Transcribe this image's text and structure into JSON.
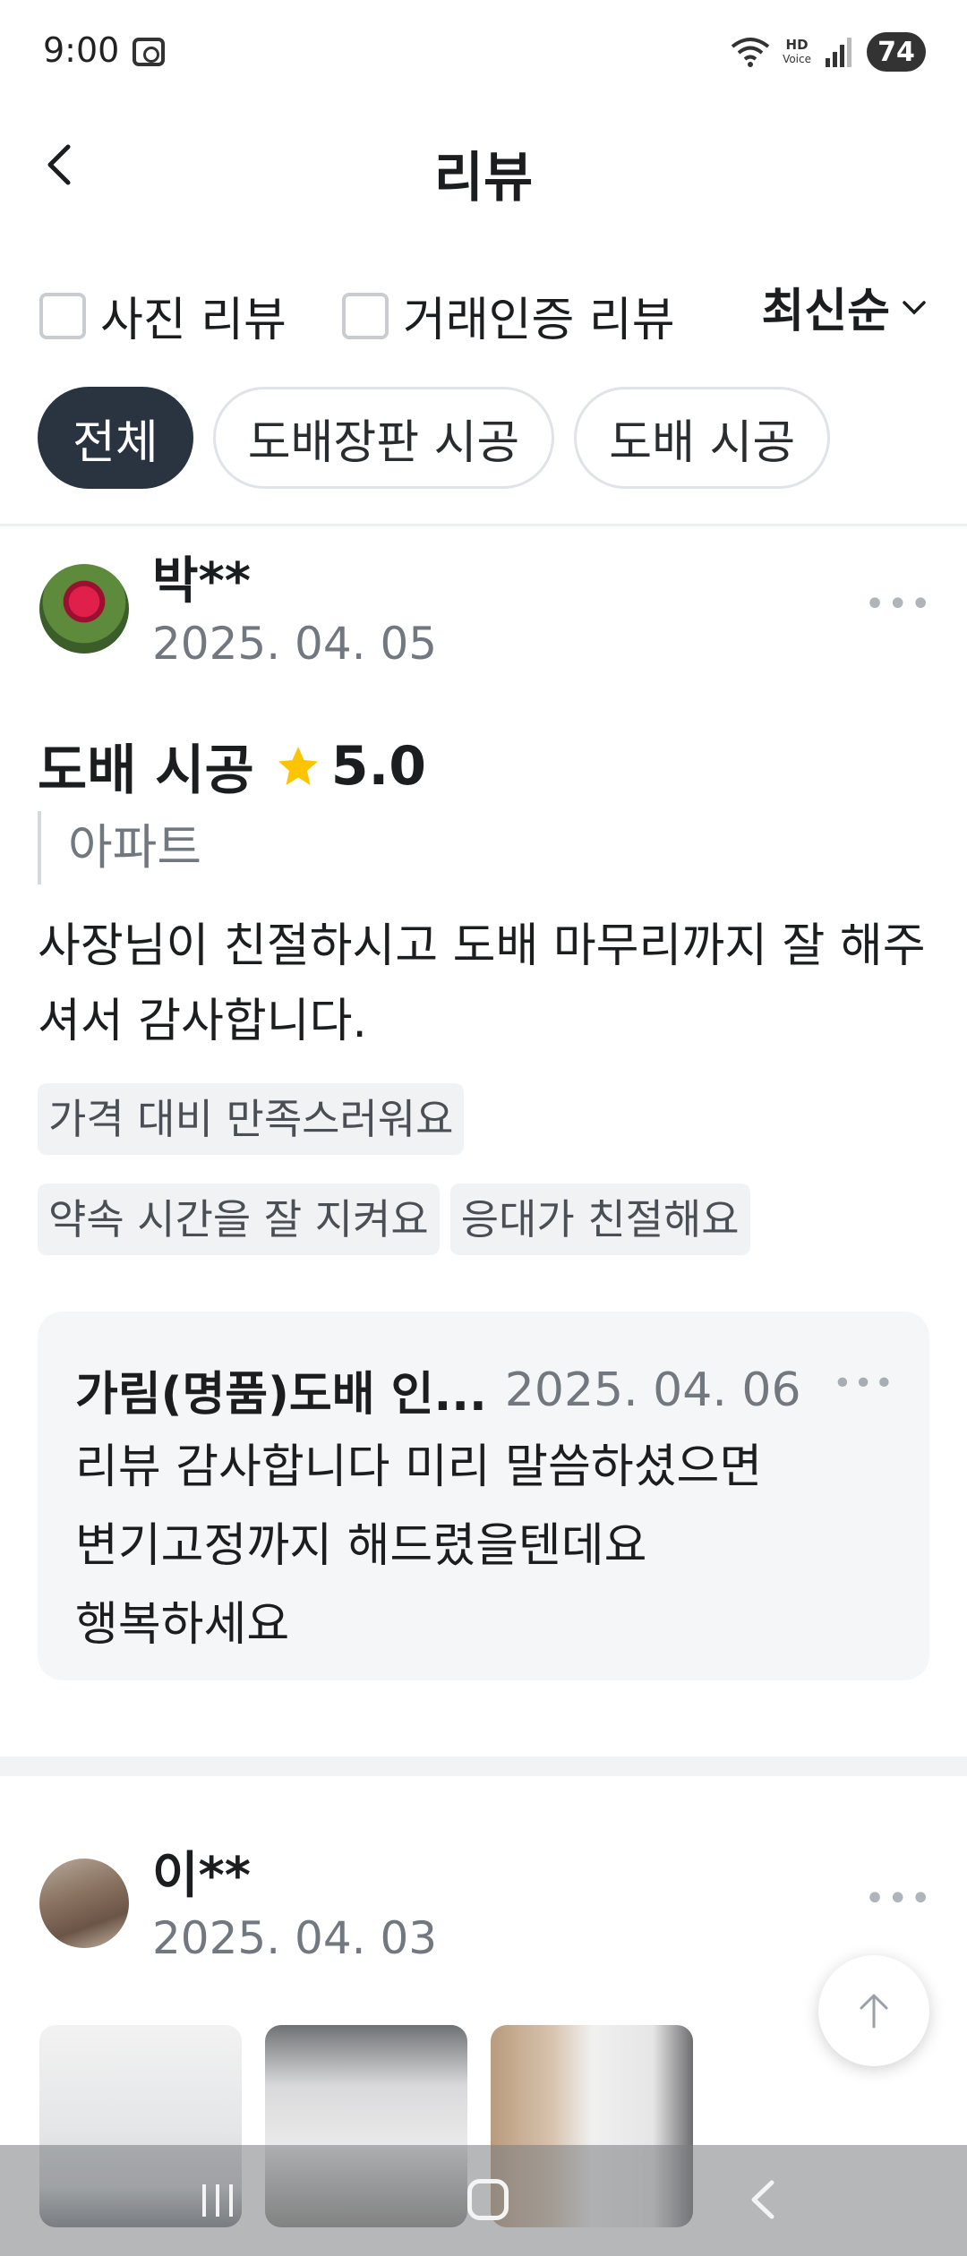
{
  "status": {
    "time": "9:00",
    "hd_label": "HD",
    "voice_label": "Voice",
    "battery": "74"
  },
  "header": {
    "title": "리뷰"
  },
  "filters": {
    "photo_review": "사진 리뷰",
    "verified_review": "거래인증 리뷰",
    "sort": "최신순"
  },
  "chips": [
    "전체",
    "도배장판 시공",
    "도배 시공"
  ],
  "reviews": [
    {
      "name": "박**",
      "date": "2025. 04. 05",
      "service": "도배 시공",
      "rating": "5.0",
      "type": "아파트",
      "text": "사장님이 친절하시고 도배 마무리까지 잘 해주셔서 감사합니다.",
      "tags": [
        "가격 대비 만족스러워요",
        "약속 시간을 잘 지켜요",
        "응대가 친절해요"
      ],
      "reply": {
        "author": "가림(명품)도배 인...",
        "date": "2025. 04. 06",
        "text": "리뷰 감사합니다 미리 말씀하셨으면\n변기고정까지 해드렸을텐데요\n행복하세요"
      }
    },
    {
      "name": "이**",
      "date": "2025. 04. 03"
    }
  ],
  "icons": {
    "back": "chevron-left-icon",
    "sort": "chevron-down-icon",
    "star": "star-icon",
    "more": "more-horizontal-icon",
    "scroll_top": "arrow-up-icon"
  },
  "colors": {
    "active_chip": "#2a3441",
    "star": "#ffc400",
    "muted_text": "#72787f"
  }
}
